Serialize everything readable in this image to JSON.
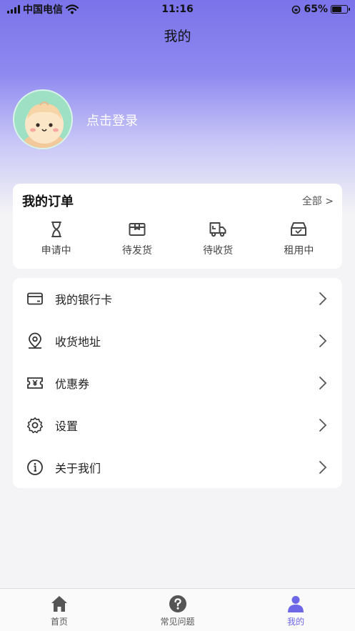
{
  "status_bar": {
    "carrier": "中国电信",
    "time": "11:16",
    "battery": "65%",
    "battery_level": 0.65
  },
  "header": {
    "title": "我的"
  },
  "profile": {
    "login_text": "点击登录",
    "avatar_icon": "avatar-mascot"
  },
  "orders": {
    "title": "我的订单",
    "all_label": "全部 >",
    "items": [
      {
        "label": "申请中",
        "icon": "hourglass-icon"
      },
      {
        "label": "待发货",
        "icon": "package-box-icon"
      },
      {
        "label": "待收货",
        "icon": "delivery-truck-icon"
      },
      {
        "label": "租用中",
        "icon": "tray-check-icon"
      }
    ]
  },
  "menu": {
    "items": [
      {
        "label": "我的银行卡",
        "icon": "bank-card-icon"
      },
      {
        "label": "收货地址",
        "icon": "location-pin-icon"
      },
      {
        "label": "优惠券",
        "icon": "coupon-icon"
      },
      {
        "label": "设置",
        "icon": "gear-icon"
      },
      {
        "label": "关于我们",
        "icon": "info-icon"
      }
    ]
  },
  "tabbar": {
    "items": [
      {
        "label": "首页",
        "icon": "home-icon",
        "active": false
      },
      {
        "label": "常见问题",
        "icon": "question-icon",
        "active": false
      },
      {
        "label": "我的",
        "icon": "user-icon",
        "active": true
      }
    ]
  },
  "colors": {
    "accent": "#6d66e6",
    "hero_top": "#7a73ea",
    "background": "#f4f4f6",
    "icon": "#444444"
  }
}
